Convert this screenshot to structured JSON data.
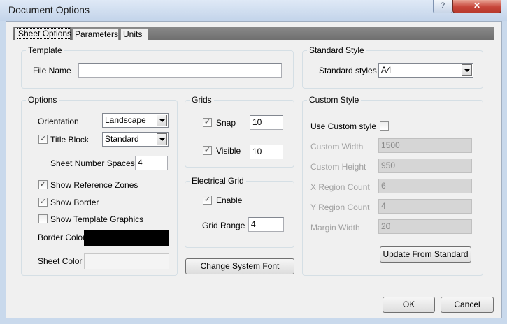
{
  "window": {
    "title": "Document Options",
    "help_label": "?",
    "close_label": "✕"
  },
  "tabs": [
    {
      "label": "Sheet Options",
      "active": true
    },
    {
      "label": "Parameters"
    },
    {
      "label": "Units"
    }
  ],
  "template": {
    "group_title": "Template",
    "file_name_label": "File Name",
    "file_name_value": ""
  },
  "standard_style": {
    "group_title": "Standard Style",
    "styles_label": "Standard styles",
    "styles_value": "A4"
  },
  "options": {
    "group_title": "Options",
    "orientation_label": "Orientation",
    "orientation_value": "Landscape",
    "title_block_label": "Title Block",
    "title_block_checked": true,
    "title_block_value": "Standard",
    "sheet_number_spaces_label": "Sheet Number Spaces",
    "sheet_number_spaces_value": "4",
    "show_reference_zones_label": "Show Reference Zones",
    "show_reference_zones_checked": true,
    "show_border_label": "Show Border",
    "show_border_checked": true,
    "show_template_graphics_label": "Show Template Graphics",
    "show_template_graphics_checked": false,
    "border_color_label": "Border Color",
    "border_color": "#000000",
    "sheet_color_label": "Sheet Color",
    "sheet_color": "#f4f4f4"
  },
  "grids": {
    "group_title": "Grids",
    "snap_label": "Snap",
    "snap_checked": true,
    "snap_value": "10",
    "visible_label": "Visible",
    "visible_checked": true,
    "visible_value": "10"
  },
  "electrical_grid": {
    "group_title": "Electrical Grid",
    "enable_label": "Enable",
    "enable_checked": true,
    "grid_range_label": "Grid Range",
    "grid_range_value": "4"
  },
  "change_system_font_label": "Change System Font",
  "custom_style": {
    "group_title": "Custom Style",
    "use_custom_label": "Use Custom style",
    "use_custom_checked": false,
    "fields": [
      {
        "label": "Custom Width",
        "value": "1500"
      },
      {
        "label": "Custom Height",
        "value": "950"
      },
      {
        "label": "X Region Count",
        "value": "6"
      },
      {
        "label": "Y Region Count",
        "value": "4"
      },
      {
        "label": "Margin Width",
        "value": "20"
      }
    ],
    "update_button_label": "Update From Standard"
  },
  "footer": {
    "ok_label": "OK",
    "cancel_label": "Cancel"
  }
}
